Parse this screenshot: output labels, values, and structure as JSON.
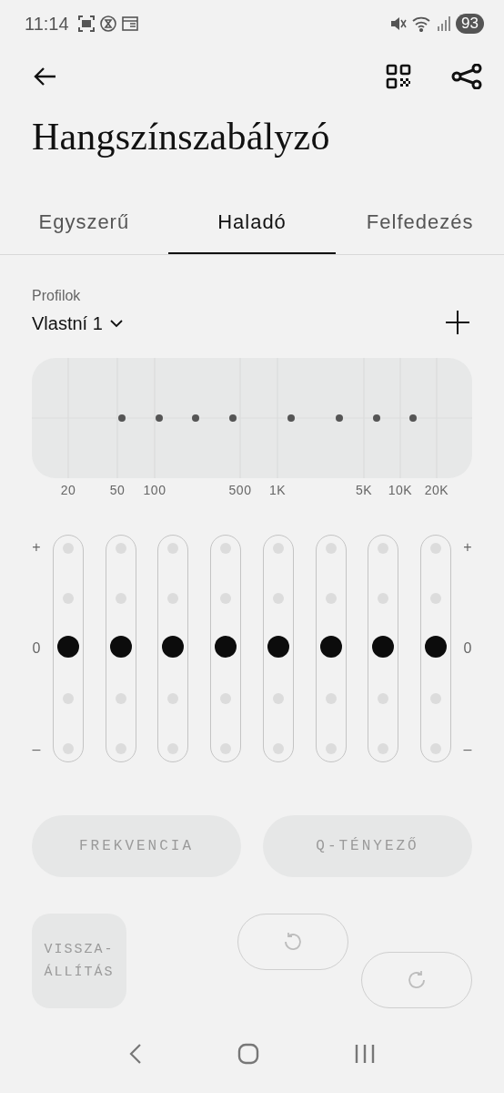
{
  "status_bar": {
    "time": "11:14",
    "battery": "93"
  },
  "title": "Hangszínszabályzó",
  "tabs": [
    {
      "label": "Egyszerű",
      "selected": false
    },
    {
      "label": "Haladó",
      "selected": true
    },
    {
      "label": "Felfedezés",
      "selected": false
    }
  ],
  "profiles": {
    "label": "Profilok",
    "value": "Vlastní 1"
  },
  "graph": {
    "x_labels": [
      "20",
      "50",
      "100",
      "500",
      "1K",
      "5K",
      "10K",
      "20K"
    ]
  },
  "scale_left": {
    "top": "+",
    "middle": "0",
    "bottom": "–"
  },
  "scale_right": {
    "top": "+",
    "middle": "0",
    "bottom": "–"
  },
  "bands": [
    {
      "level": 0.5
    },
    {
      "level": 0.5
    },
    {
      "level": 0.5
    },
    {
      "level": 0.5
    },
    {
      "level": 0.5
    },
    {
      "level": 0.5
    },
    {
      "level": 0.5
    },
    {
      "level": 0.5
    }
  ],
  "mode_buttons": [
    {
      "label": "FREKVENCIA",
      "disabled": true
    },
    {
      "label": "Q-TÉNYEZŐ",
      "disabled": true
    }
  ],
  "reset_button": {
    "label": "VISSZA-\nÁLLÍTÁS",
    "disabled": true
  },
  "undo": {
    "disabled": true
  },
  "redo": {
    "disabled": true
  }
}
